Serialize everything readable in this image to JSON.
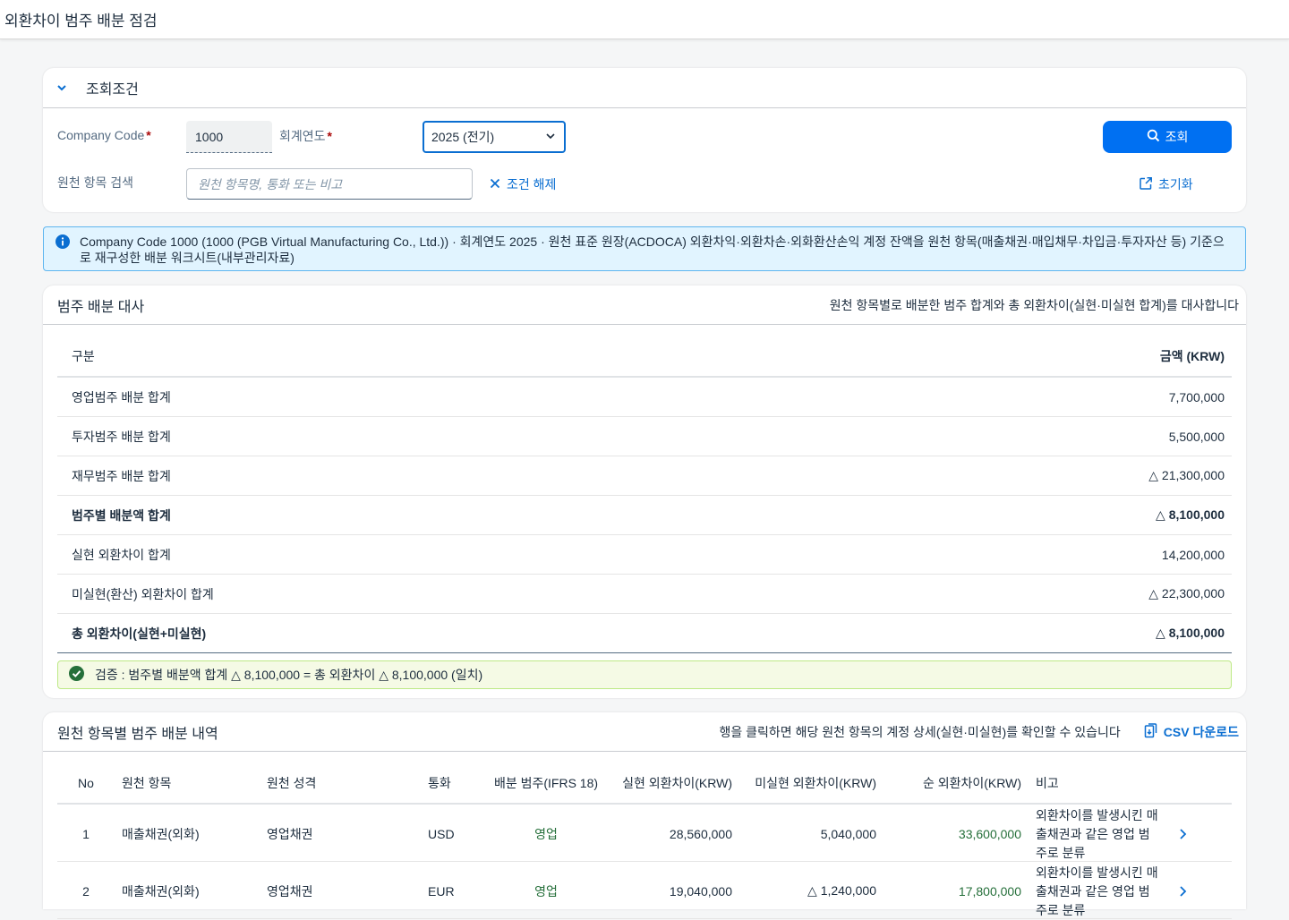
{
  "shell": {
    "title": "외환차이 범주 배분 점검"
  },
  "filter": {
    "title": "조회조건",
    "company_code_label": "Company Code",
    "company_code_value": "1000",
    "fiscal_year_label": "회계연도",
    "fiscal_year_value": "2025 (전기)",
    "search_label": "원천 항목 검색",
    "search_placeholder": "원천 항목명, 통화 또는 비고",
    "clear_label": "조건 해제",
    "go_label": "조회",
    "reset_label": "초기화",
    "required_mark": "*"
  },
  "info": {
    "text": "Company Code 1000 (1000 (PGB Virtual Manufacturing Co., Ltd.)) · 회계연도 2025 · 원천 표준 원장(ACDOCA) 외환차익·외환차손·외화환산손익 계정 잔액을 원천 항목(매출채권·매입채무·차입금·투자자산 등) 기준으로 재구성한 배분 워크시트(내부관리자료)"
  },
  "recon": {
    "title": "범주 배분 대사",
    "subtitle": "원천 항목별로 배분한 범주 합계와 총 외환차이(실현·미실현 합계)를 대사합니다",
    "col_label": "구분",
    "col_amount": "금액 (KRW)",
    "rows": [
      {
        "label": "영업범주 배분 합계",
        "amount": "7,700,000"
      },
      {
        "label": "투자범주 배분 합계",
        "amount": "5,500,000"
      },
      {
        "label": "재무범주 배분 합계",
        "amount": "△ 21,300,000"
      },
      {
        "label": "범주별 배분액 합계",
        "amount": "△ 8,100,000"
      },
      {
        "label": "실현 외환차이 합계",
        "amount": "14,200,000"
      },
      {
        "label": "미실현(환산) 외환차이 합계",
        "amount": "△ 22,300,000"
      },
      {
        "label": "총 외환차이(실현+미실현)",
        "amount": "△ 8,100,000"
      }
    ],
    "verify_text": "검증 : 범주별 배분액 합계 △ 8,100,000 = 총 외환차이 △ 8,100,000 (일치)",
    "colors": {
      "success": "#256f3a",
      "success_bg": "#f5fae5"
    }
  },
  "detail": {
    "title": "원천 항목별 범주 배분 내역",
    "hint": "행을 클릭하면 해당 원천 항목의 계정 상세(실현·미실현)를 확인할 수 있습니다",
    "csv_label": "CSV 다운로드",
    "columns": {
      "no": "No",
      "item": "원천 항목",
      "nature": "원천 성격",
      "currency": "통화",
      "category": "배분 범주(IFRS 18)",
      "realized": "실현 외환차이(KRW)",
      "unrealized": "미실현 외환차이(KRW)",
      "net": "순 외환차이(KRW)",
      "note": "비고"
    },
    "rows": [
      {
        "no": "1",
        "item": "매출채권(외화)",
        "nature": "영업채권",
        "currency": "USD",
        "category": "영업",
        "realized": "28,560,000",
        "unrealized": "5,040,000",
        "net": "33,600,000",
        "note": "외환차이를 발생시킨 매출채권과 같은 영업 범주로 분류"
      },
      {
        "no": "2",
        "item": "매출채권(외화)",
        "nature": "영업채권",
        "currency": "EUR",
        "category": "영업",
        "realized": "19,040,000",
        "unrealized": "△ 1,240,000",
        "net": "17,800,000",
        "note": "외환차이를 발생시킨 매출채권과 같은 영업 범주로 분류"
      }
    ]
  }
}
